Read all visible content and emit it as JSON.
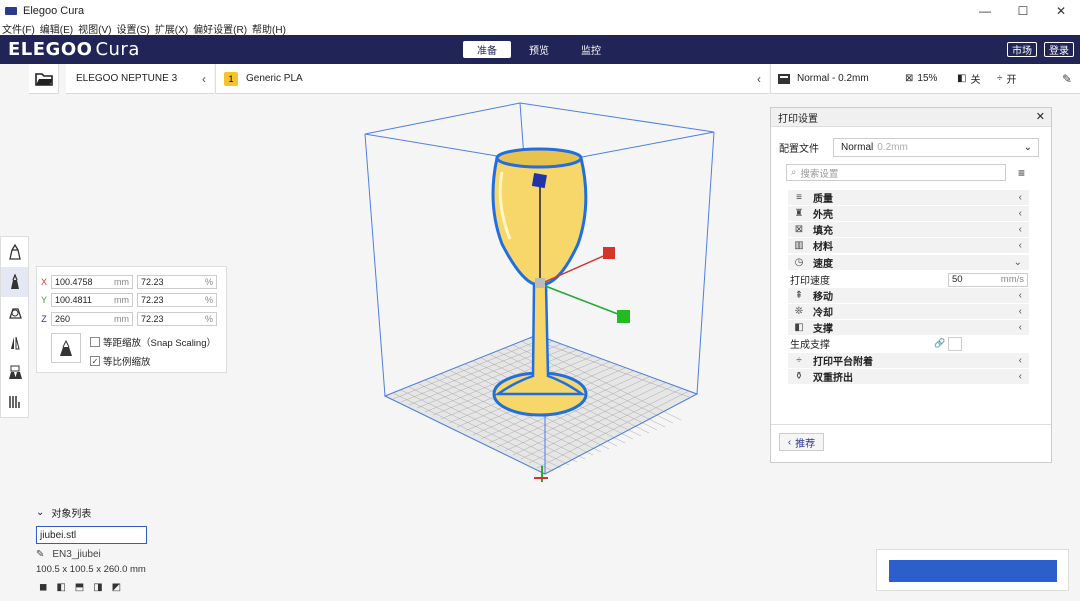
{
  "window": {
    "title": "Elegoo Cura",
    "min": "—",
    "max": "☐",
    "close": "✕"
  },
  "menu": [
    "文件(F)",
    "编辑(E)",
    "视图(V)",
    "设置(S)",
    "扩展(X)",
    "偏好设置(R)",
    "帮助(H)"
  ],
  "header": {
    "logo_main": "ELEGOO",
    "logo_sub": "Cura",
    "tabs": [
      "准备",
      "预览",
      "监控"
    ],
    "market": "市场",
    "login": "登录"
  },
  "toolbar": {
    "printer": "ELEGOO NEPTUNE 3",
    "material_badge": "1",
    "material": "Generic PLA",
    "profile": "Normal - 0.2mm",
    "infill": "15%",
    "support": "关",
    "adhesion": "开"
  },
  "scale": {
    "x_mm": "100.4758",
    "x_pct": "72.23",
    "y_mm": "100.4811",
    "y_pct": "72.23",
    "z_mm": "260",
    "z_pct": "72.23",
    "unit_mm": "mm",
    "unit_pct": "%",
    "snap": "等距缩放（Snap Scaling）",
    "uniform": "等比例缩放"
  },
  "object_list": {
    "title": "对象列表",
    "filename": "jiubei.stl",
    "job_name": "EN3_jiubei",
    "dimensions": "100.5 x 100.5 x 260.0 mm"
  },
  "print_settings": {
    "title": "打印设置",
    "profile_label": "配置文件",
    "profile_value": "Normal",
    "profile_grey": "0.2mm",
    "search_placeholder": "搜索设置",
    "categories": [
      {
        "label": "质量",
        "icon": "≡"
      },
      {
        "label": "外壳",
        "icon": "♜"
      },
      {
        "label": "填充",
        "icon": "⊠"
      },
      {
        "label": "材料",
        "icon": "▥"
      },
      {
        "label": "速度",
        "icon": "◷"
      }
    ],
    "print_speed_label": "打印速度",
    "print_speed_value": "50",
    "print_speed_unit": "mm/s",
    "categories2": [
      {
        "label": "移动",
        "icon": "⇞"
      },
      {
        "label": "冷却",
        "icon": "❊"
      },
      {
        "label": "支撑",
        "icon": "◧"
      }
    ],
    "gen_support_label": "生成支撑",
    "categories3": [
      {
        "label": "打印平台附着",
        "icon": "÷"
      },
      {
        "label": "双重挤出",
        "icon": "⚱"
      }
    ],
    "recommend": "推荐"
  },
  "colors": {
    "header_bg": "#202456",
    "accent": "#2c5fc9",
    "model": "#f7d66a",
    "model_outline": "#1f6fe0"
  }
}
